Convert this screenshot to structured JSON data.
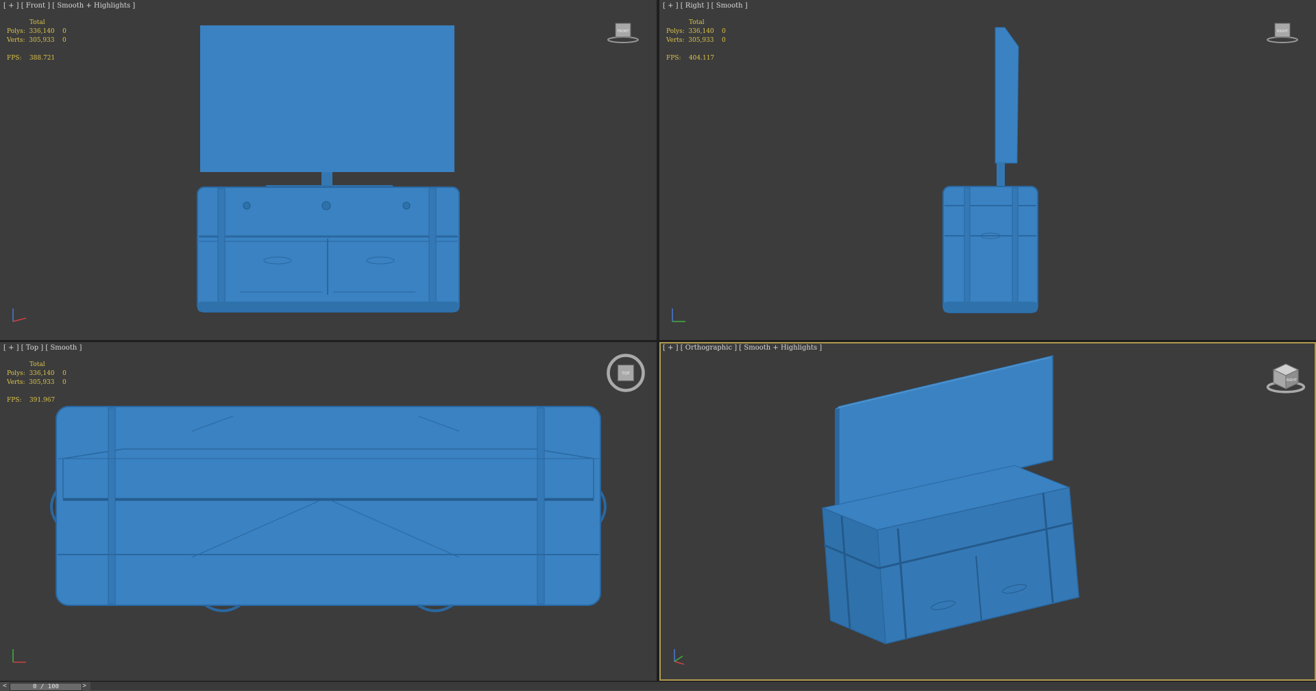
{
  "viewports": {
    "front": {
      "label": "[ + ] [ Front ] [ Smooth + Highlights ]"
    },
    "right": {
      "label": "[ + ] [ Right ] [ Smooth ]"
    },
    "top": {
      "label": "[ + ] [ Top ] [ Smooth ]"
    },
    "ortho": {
      "label": "[ + ] [ Orthographic ] [ Smooth + Highlights ]"
    }
  },
  "stats": {
    "front": {
      "total": "Total",
      "polys": "Polys:  336,140    0",
      "verts": "Verts:  305,933    0",
      "fps": "FPS:    388.721"
    },
    "right": {
      "total": "Total",
      "polys": "Polys:  336,140    0",
      "verts": "Verts:  305,933    0",
      "fps": "FPS:    404.117"
    },
    "top": {
      "total": "Total",
      "polys": "Polys:  336,140    0",
      "verts": "Verts:  305,933    0",
      "fps": "FPS:    391.967"
    }
  },
  "viewcube": {
    "front": "FRONT",
    "right": "RIGHT",
    "top": "TOP",
    "ortho": "RIGHT"
  },
  "timeline": {
    "frame": "0 / 100",
    "prev": "<",
    "next": ">"
  },
  "colors": {
    "model": "#3a82c2",
    "model_dark": "#2a67a0",
    "viewport": "#3c3c3c",
    "active_border": "#b39b4e",
    "stats": "#dcc44a"
  }
}
